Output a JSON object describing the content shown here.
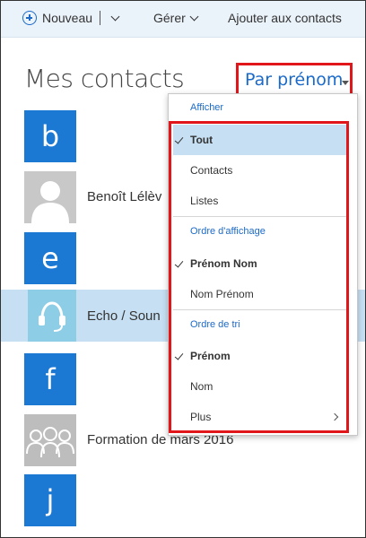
{
  "toolbar": {
    "new_label": "Nouveau",
    "manage_label": "Gérer",
    "add_contacts_label": "Ajouter aux contacts"
  },
  "heading": {
    "title": "Mes contacts",
    "sort_label": "Par prénom"
  },
  "contacts": [
    {
      "type": "letter",
      "text": "b"
    },
    {
      "type": "contact",
      "name": "Benoît Lélèv",
      "icon": "person-icon"
    },
    {
      "type": "letter",
      "text": "e"
    },
    {
      "type": "contact",
      "name": "Echo / Soun",
      "icon": "headset-icon",
      "selected": true
    },
    {
      "type": "letter",
      "text": "f"
    },
    {
      "type": "contact",
      "name": "Formation de mars 2016",
      "icon": "group-icon"
    },
    {
      "type": "letter",
      "text": "j"
    }
  ],
  "menu": {
    "show_header": "Afficher",
    "show_items": [
      {
        "label": "Tout",
        "checked": true
      },
      {
        "label": "Contacts",
        "checked": false
      },
      {
        "label": "Listes",
        "checked": false
      }
    ],
    "display_header": "Ordre d'affichage",
    "display_items": [
      {
        "label": "Prénom Nom",
        "checked": true
      },
      {
        "label": "Nom Prénom",
        "checked": false
      }
    ],
    "sort_header": "Ordre de tri",
    "sort_items": [
      {
        "label": "Prénom",
        "checked": true
      },
      {
        "label": "Nom",
        "checked": false
      },
      {
        "label": "Plus",
        "checked": false,
        "submenu": true
      }
    ]
  },
  "colors": {
    "accent": "#1b6ac9",
    "tile": "#1b78d3",
    "selection": "#c6dff3",
    "annotation_red": "#e0161b"
  }
}
